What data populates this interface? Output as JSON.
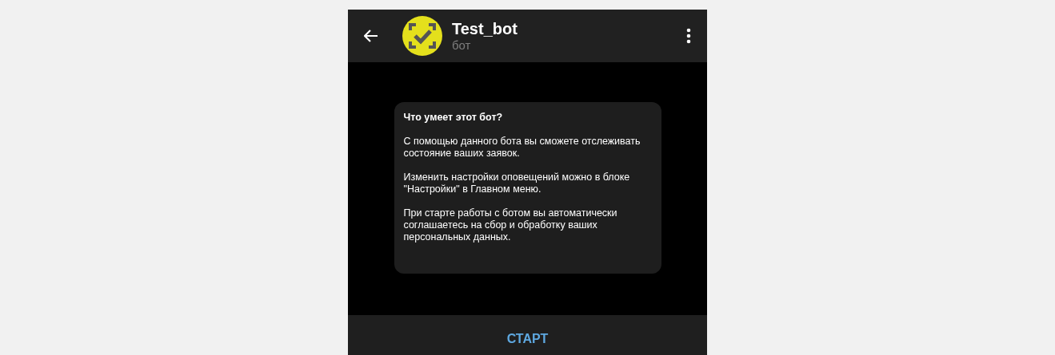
{
  "header": {
    "title": "Test_bot",
    "subtitle": "бот"
  },
  "intro_card": {
    "heading": "Что умеет этот бот?",
    "paragraphs": [
      "С помощью данного бота вы сможете отслеживать состояние ваших заявок.",
      "Изменить настройки оповещений можно в блоке \"Настройки\" в Главном меню.",
      "При старте работы с ботом вы автоматически соглашаетесь на сбор и обработку ваших персональных данных."
    ]
  },
  "start_button": "СТАРТ"
}
